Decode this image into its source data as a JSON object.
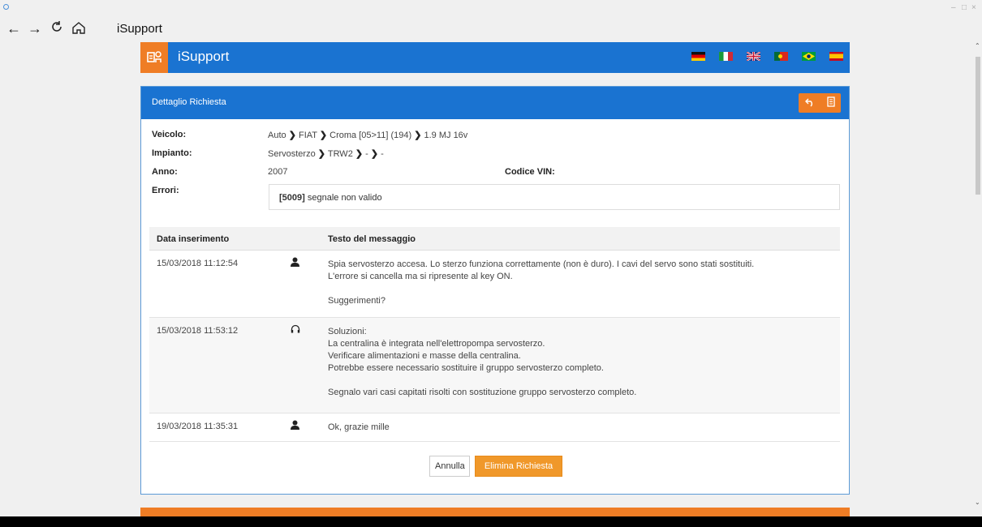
{
  "window": {
    "minimize": "–",
    "maximize": "□",
    "close": "×"
  },
  "nav": {
    "title": "iSupport",
    "back_icon": "←",
    "forward_icon": "→",
    "refresh_icon": "↻",
    "home_icon": "⌂"
  },
  "header": {
    "app_name": "iSupport",
    "flags": [
      "de",
      "it",
      "gb",
      "pt",
      "br",
      "es"
    ]
  },
  "card": {
    "title": "Dettaglio Richiesta",
    "veicolo_label": "Veicolo:",
    "veicolo": [
      "Auto",
      "FIAT",
      "Croma [05>11] (194)",
      "1.9 MJ 16v"
    ],
    "impianto_label": "Impianto:",
    "impianto": [
      "Servosterzo",
      "TRW2",
      "-",
      "-"
    ],
    "anno_label": "Anno:",
    "anno": "2007",
    "vin_label": "Codice VIN:",
    "errori_label": "Errori:",
    "error_code": "[5009]",
    "error_text": "segnale non valido"
  },
  "table": {
    "col_date": "Data inserimento",
    "col_msg": "Testo del messaggio",
    "rows": [
      {
        "date": "15/03/2018 11:12:54",
        "icon": "user-icon",
        "lines": [
          "Spia servosterzo accesa. Lo sterzo funziona correttamente (non è duro). I cavi del servo sono stati sostituiti.",
          "L'errore si cancella ma si ripresente al key ON.",
          "",
          "Suggerimenti?"
        ]
      },
      {
        "date": "15/03/2018 11:53:12",
        "icon": "headset-icon",
        "lines": [
          "Soluzioni:",
          "La centralina è integrata nell'elettropompa servosterzo.",
          "Verificare alimentazioni e masse della centralina.",
          "Potrebbe essere necessario sostituire il gruppo servosterzo completo.",
          "",
          "Segnalo vari casi capitati risolti con sostituzione gruppo servosterzo completo."
        ]
      },
      {
        "date": "19/03/2018 11:35:31",
        "icon": "user-icon",
        "lines": [
          "Ok, grazie mille"
        ]
      }
    ]
  },
  "buttons": {
    "cancel": "Annulla",
    "delete": "Elimina Richiesta"
  },
  "colors": {
    "brand_blue": "#1a73d1",
    "brand_orange": "#ef7d25"
  }
}
